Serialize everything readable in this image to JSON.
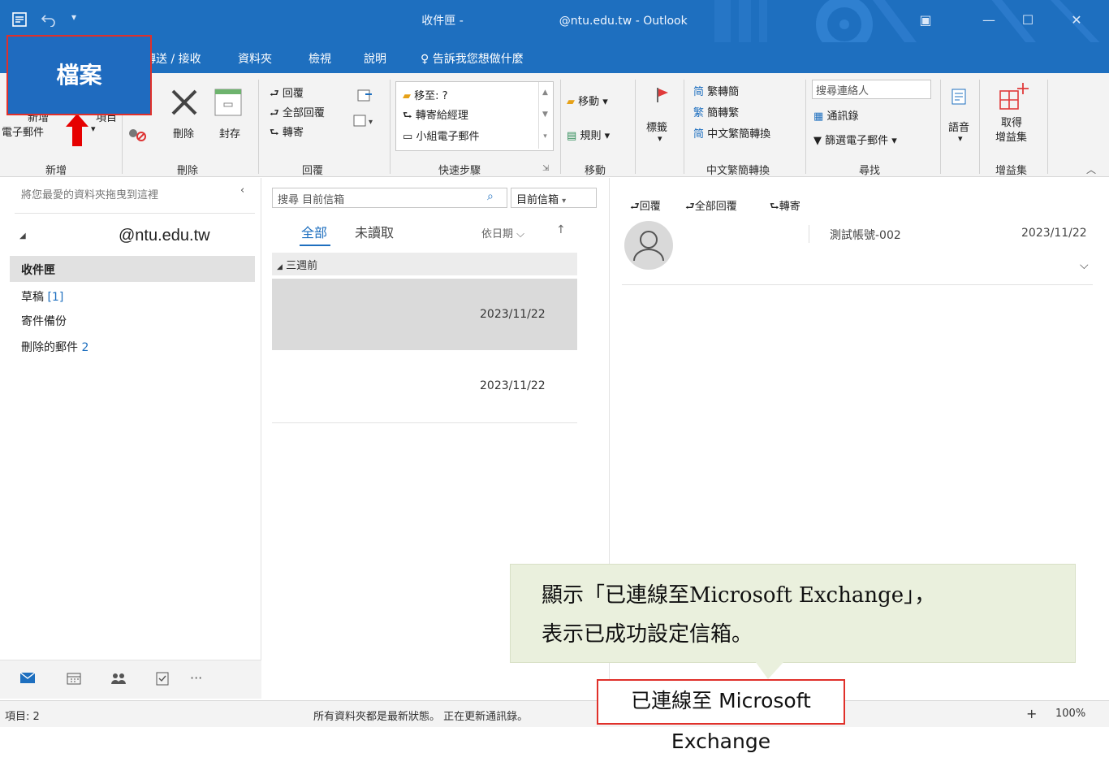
{
  "titlebar": {
    "title_part1": "收件匣 -",
    "title_part2": "@ntu.edu.tw - Outlook",
    "undo_icon": "undo-icon",
    "colors": {
      "accent": "#1e6fbf",
      "highlight": "#e0302a"
    }
  },
  "ribbon_tabs": {
    "file": "檔案",
    "send_receive": "傳送 / 接收",
    "folder": "資料夾",
    "view": "檢視",
    "help": "說明",
    "tell_me": "告訴我您想做什麼"
  },
  "ribbon": {
    "new_email_line1": "新增",
    "new_email_line2": "電子郵件",
    "new_items": "項目",
    "group_new": "新增",
    "delete": "刪除",
    "archive": "封存",
    "group_delete": "刪除",
    "reply": "回覆",
    "reply_all": "全部回覆",
    "forward": "轉寄",
    "group_respond": "回覆",
    "qs_move_to": "移至: ?",
    "qs_to_manager": "轉寄給經理",
    "qs_team_email": "小組電子郵件",
    "group_quicksteps": "快速步驟",
    "move": "移動",
    "rules": "規則",
    "group_move": "移動",
    "tags": "標籤",
    "trad_to_simp": "繁轉簡",
    "simp_to_trad": "簡轉繁",
    "chinese_conversion": "中文繁簡轉換",
    "group_chinese": "中文繁簡轉換",
    "search_people_placeholder": "搜尋連絡人",
    "address_book": "通訊錄",
    "filter_email": "篩選電子郵件",
    "group_find": "尋找",
    "speech": "語音",
    "get_addins_line1": "取得",
    "get_addins_line2": "增益集",
    "group_addins": "增益集"
  },
  "folder_pane": {
    "drag_hint": "將您最愛的資料夾拖曳到這裡",
    "account": "@ntu.edu.tw",
    "folders": [
      {
        "label": "收件匣",
        "count": ""
      },
      {
        "label": "草稿",
        "count": "[1]"
      },
      {
        "label": "寄件備份",
        "count": ""
      },
      {
        "label": "刪除的郵件",
        "count": "2"
      }
    ]
  },
  "message_list": {
    "search_placeholder": "搜尋 目前信箱",
    "scope": "目前信箱",
    "tab_all": "全部",
    "tab_unread": "未讀取",
    "sort": "依日期",
    "group_header": "三週前",
    "items": [
      {
        "date": "2023/11/22"
      },
      {
        "date": "2023/11/22"
      }
    ]
  },
  "reading_pane": {
    "reply": "回覆",
    "reply_all": "全部回覆",
    "forward": "轉寄",
    "sender": "測試帳號-002",
    "date": "2023/11/22"
  },
  "nav": {
    "mail_icon": "mail-icon",
    "calendar_icon": "calendar-icon",
    "people_icon": "people-icon",
    "tasks_icon": "tasks-icon",
    "more": "···"
  },
  "status": {
    "items": "項目: 2",
    "message": "所有資料夾都是最新狀態。 正在更新通訊錄。",
    "zoom": "100%"
  },
  "callout": {
    "line1": "顯示「已連線至Microsoft Exchange」，",
    "line2": "表示已成功設定信箱。",
    "connected": "已連線至 Microsoft Exchange"
  }
}
